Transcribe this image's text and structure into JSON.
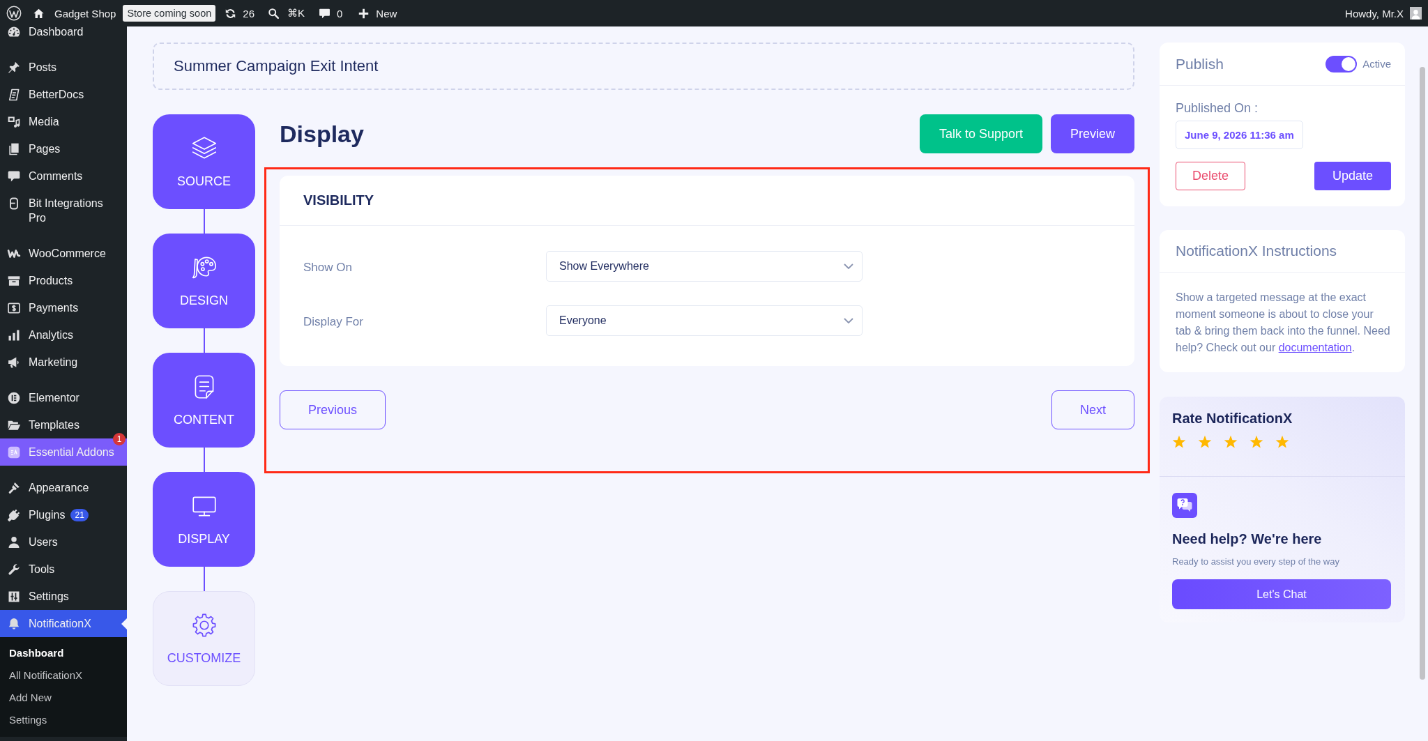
{
  "admin_bar": {
    "site_name": "Gadget Shop",
    "store_badge": "Store coming soon",
    "updates": "26",
    "search_shortcut": "⌘K",
    "comments": "0",
    "new_label": "New",
    "greeting": "Howdy, Mr.X"
  },
  "sidebar": {
    "groups": [
      {
        "items": [
          {
            "label": "Dashboard",
            "selected": false,
            "highlighted": false
          }
        ]
      },
      {
        "items": [
          {
            "label": "Posts",
            "selected": false,
            "highlighted": false
          },
          {
            "label": "BetterDocs",
            "selected": false,
            "highlighted": false
          },
          {
            "label": "Media",
            "selected": false,
            "highlighted": false
          },
          {
            "label": "Pages",
            "selected": false,
            "highlighted": false
          },
          {
            "label": "Comments",
            "selected": false,
            "highlighted": false
          },
          {
            "label": "Bit Integrations Pro",
            "selected": false,
            "highlighted": false
          }
        ]
      },
      {
        "items": [
          {
            "label": "WooCommerce",
            "selected": false,
            "highlighted": false
          },
          {
            "label": "Products",
            "selected": false,
            "highlighted": false
          },
          {
            "label": "Payments",
            "selected": false,
            "highlighted": false
          },
          {
            "label": "Analytics",
            "selected": false,
            "highlighted": false
          },
          {
            "label": "Marketing",
            "selected": false,
            "highlighted": false
          }
        ]
      },
      {
        "items": [
          {
            "label": "Elementor",
            "selected": false,
            "highlighted": false
          },
          {
            "label": "Templates",
            "selected": false,
            "highlighted": false
          },
          {
            "label": "Essential Addons",
            "selected": false,
            "highlighted": true,
            "badge": {
              "text": "1",
              "kind": "corner",
              "color": "#d63638"
            }
          }
        ]
      },
      {
        "items": [
          {
            "label": "Appearance",
            "selected": false,
            "highlighted": false
          },
          {
            "label": "Plugins",
            "selected": false,
            "highlighted": false,
            "badge": {
              "text": "21",
              "kind": "inline",
              "color": "#3858e9"
            }
          },
          {
            "label": "Users",
            "selected": false,
            "highlighted": false
          },
          {
            "label": "Tools",
            "selected": false,
            "highlighted": false
          },
          {
            "label": "Settings",
            "selected": false,
            "highlighted": false
          },
          {
            "label": "NotificationX",
            "selected": true,
            "highlighted": false,
            "children": [
              {
                "label": "Dashboard",
                "selected": true
              },
              {
                "label": "All NotificationX",
                "selected": false
              },
              {
                "label": "Add New",
                "selected": false
              },
              {
                "label": "Settings",
                "selected": false
              }
            ]
          }
        ]
      }
    ]
  },
  "campaign_title": "Summer Campaign Exit Intent",
  "steps": [
    {
      "label": "SOURCE",
      "completed": true
    },
    {
      "label": "DESIGN",
      "completed": true
    },
    {
      "label": "CONTENT",
      "completed": true
    },
    {
      "label": "DISPLAY",
      "completed": true
    },
    {
      "label": "CUSTOMIZE",
      "completed": false
    }
  ],
  "page_title": "Display",
  "header_buttons": [
    {
      "label": "Talk to Support",
      "kind": "support"
    },
    {
      "label": "Preview",
      "kind": "preview"
    }
  ],
  "visibility": {
    "title": "VISIBILITY",
    "fields": [
      {
        "label": "Show On",
        "value": "Show Everywhere"
      },
      {
        "label": "Display For",
        "value": "Everyone"
      }
    ]
  },
  "navigation": {
    "previous": "Previous",
    "next": "Next"
  },
  "publish": {
    "title": "Publish",
    "active": true,
    "status_label": "Active",
    "published_on_label": "Published On :",
    "date": "June 9, 2026 11:36 am",
    "delete_label": "Delete",
    "update_label": "Update"
  },
  "instructions": {
    "title": "NotificationX Instructions",
    "text": "Show a targeted message at the exact moment someone is about to close your tab & bring them back into the funnel. Need help? Check out our ",
    "link": "documentation",
    "after_link": "."
  },
  "rating": {
    "title": "Rate NotificationX",
    "stars": 5
  },
  "help": {
    "title": "Need help? We're here",
    "subtitle": "Ready to assist you every step of the way",
    "button": "Let's Chat"
  }
}
